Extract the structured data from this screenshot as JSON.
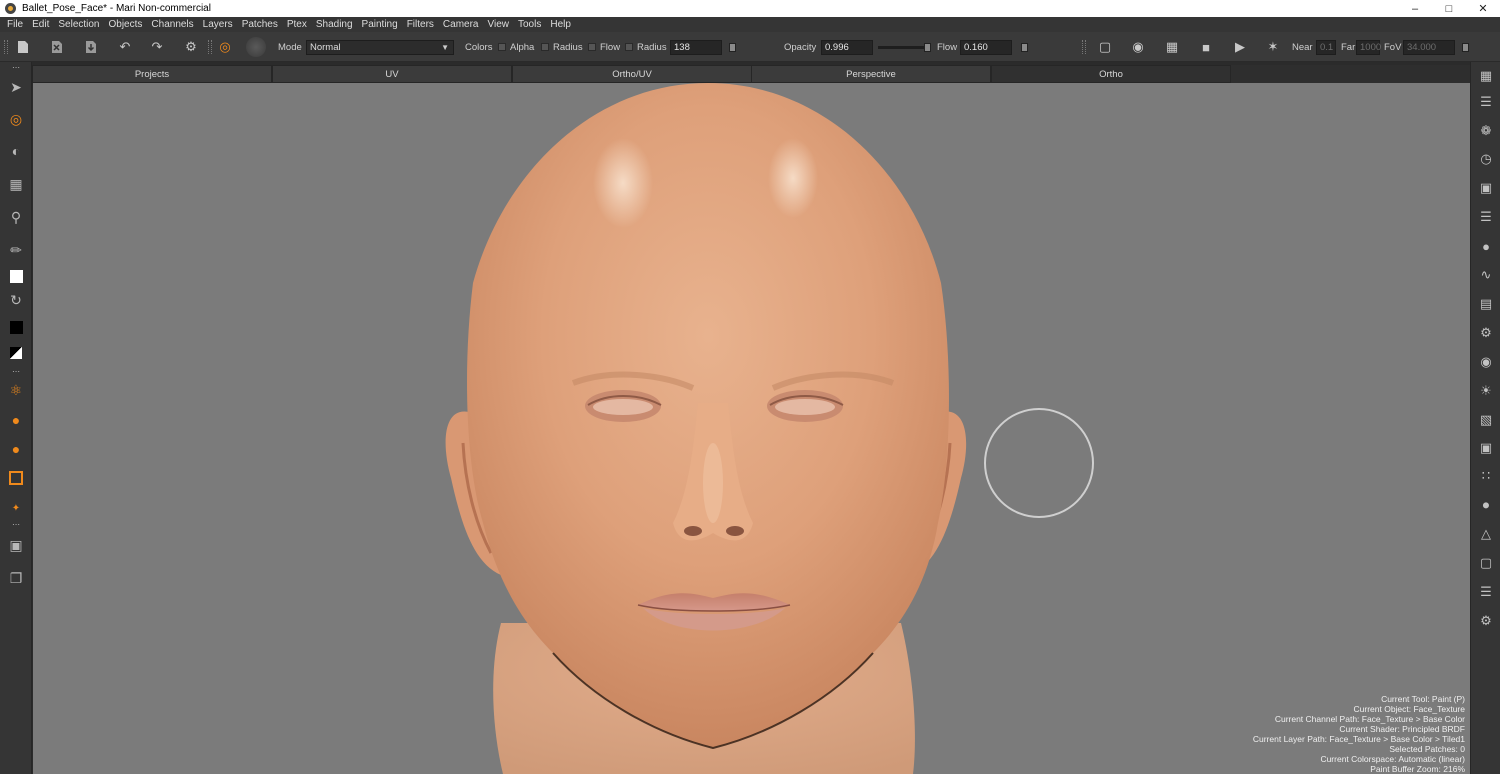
{
  "window": {
    "title": "Ballet_Pose_Face* - Mari Non-commercial"
  },
  "menu": [
    "File",
    "Edit",
    "Selection",
    "Objects",
    "Channels",
    "Layers",
    "Patches",
    "Ptex",
    "Shading",
    "Painting",
    "Filters",
    "Camera",
    "View",
    "Tools",
    "Help"
  ],
  "options": {
    "mode_label": "Mode",
    "mode_value": "Normal",
    "colors_label": "Colors",
    "alpha_label": "Alpha",
    "radius_check_label": "Radius",
    "flow_check_label": "Flow",
    "radius_label": "Radius",
    "radius_value": "138",
    "opacity_label": "Opacity",
    "opacity_value": "0.996",
    "opacity_level": 0.996,
    "flow_label": "Flow",
    "flow_value": "0.160",
    "near_label": "Near",
    "near_value": "0.1",
    "far_label": "Far",
    "far_value": "1000",
    "fov_label": "FoV",
    "fov_value": "34.000"
  },
  "tabs": [
    "Projects",
    "UV",
    "Ortho/UV",
    "Perspective",
    "Ortho"
  ],
  "active_tab": "Ortho",
  "hud": [
    "Current Tool: Paint (P)",
    "Current Object: Face_Texture",
    "Current Channel Path: Face_Texture > Base Color",
    "Current Shader: Principled BRDF",
    "Current Layer Path: Face_Texture > Base Color > Tiled1",
    "Selected Patches: 0",
    "Current Colorspace: Automatic (linear)",
    "Paint Buffer Zoom: 216%"
  ],
  "colors": {
    "viewport_bg": "#7b7b7b",
    "skin": "#e0a47f",
    "accent_orange": "#f08a1c",
    "foreground_swatch": "#ffffff",
    "background_swatch": "#000000"
  }
}
